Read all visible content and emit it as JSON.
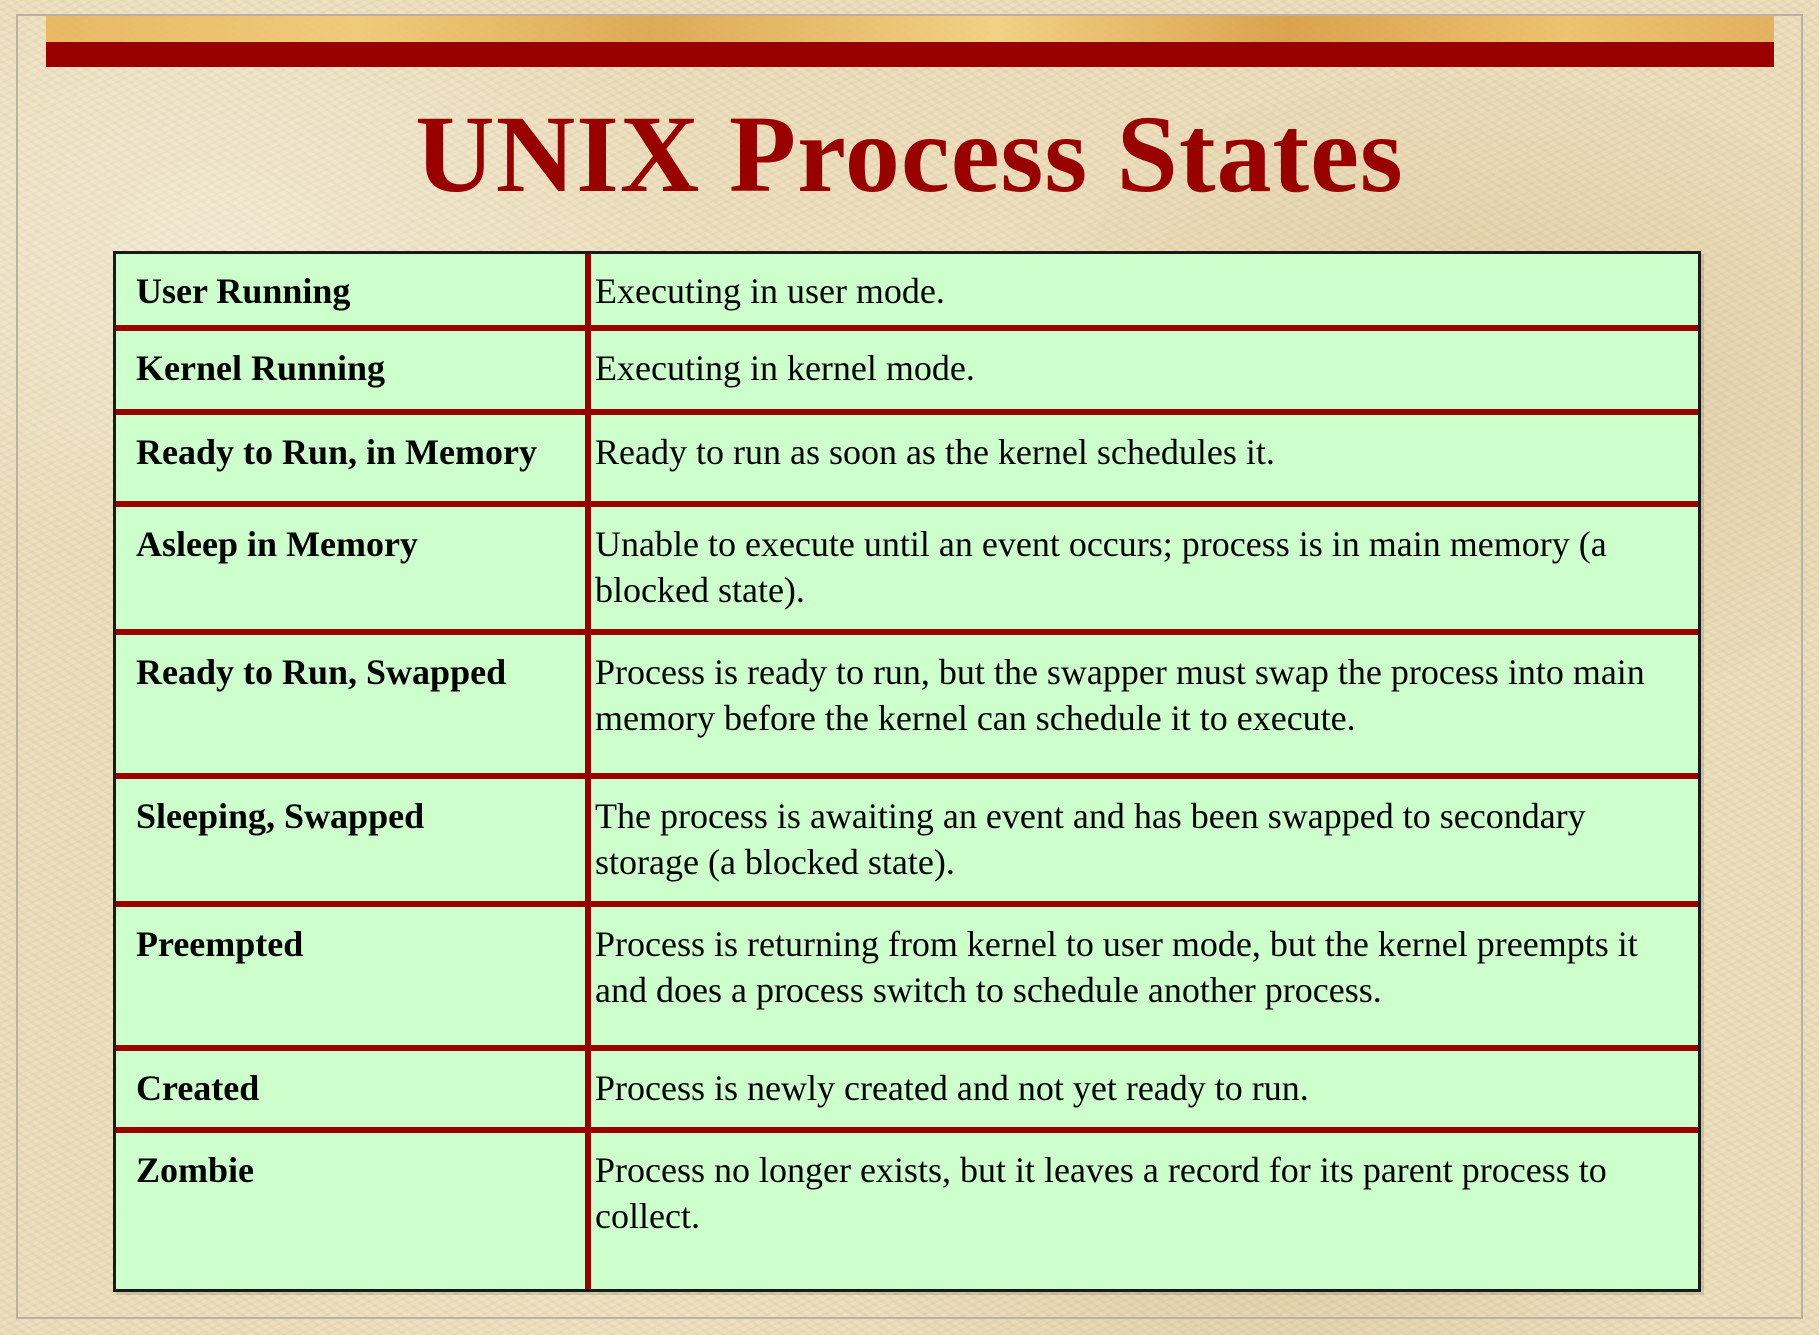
{
  "slide": {
    "title": "UNIX Process States",
    "colors": {
      "accent": "#990000",
      "table_background": "#ccffcc",
      "background": "#eadcb8"
    }
  },
  "table": {
    "rows": [
      {
        "state": "User Running",
        "description": "Executing in user mode."
      },
      {
        "state": "Kernel Running",
        "description": "Executing in kernel mode."
      },
      {
        "state": "Ready to Run, in Memory",
        "description": "Ready to run as soon as the kernel schedules it."
      },
      {
        "state": "Asleep in Memory",
        "description": "Unable to execute until an event occurs; process is in main memory (a blocked state)."
      },
      {
        "state": "Ready to Run, Swapped",
        "description": "Process is ready to run, but the swapper must swap the process into main memory before the kernel can schedule it to execute."
      },
      {
        "state": "Sleeping, Swapped",
        "description": "The process is awaiting an event and has been swapped to secondary storage (a blocked state)."
      },
      {
        "state": "Preempted",
        "description": "Process is returning from kernel to user mode, but the kernel preempts it and does a process switch to schedule another process."
      },
      {
        "state": "Created",
        "description": "Process is newly created and not yet ready to run."
      },
      {
        "state": "Zombie",
        "description": "Process no longer exists, but it leaves a record for its parent process to collect."
      }
    ]
  }
}
